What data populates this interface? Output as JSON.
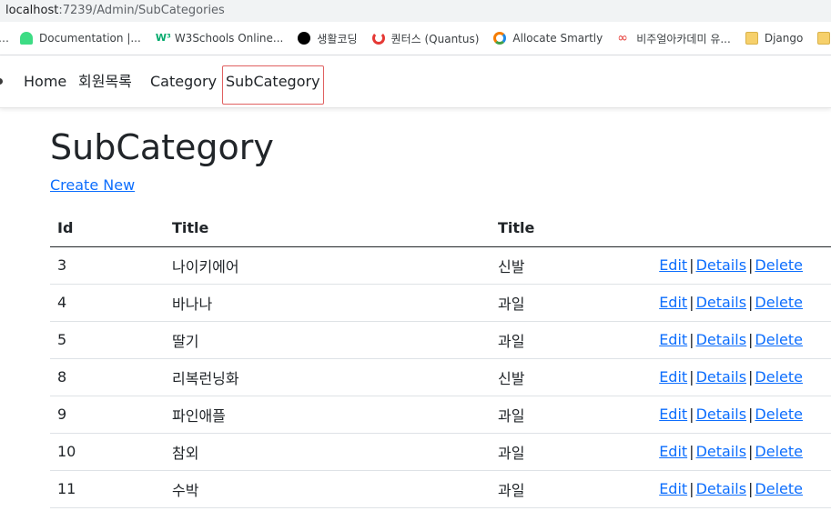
{
  "browser": {
    "url_host": "localhost",
    "url_rest": ":7239/Admin/SubCategories",
    "bookmarks": [
      {
        "label": "Documentation |...",
        "icon": "android-icon",
        "color": "#3ddc84"
      },
      {
        "label": "W3Schools Online...",
        "icon": "w3schools-icon",
        "color": "#04aa6d"
      },
      {
        "label": "생활코딩",
        "icon": "black-circle-icon",
        "color": "#000000"
      },
      {
        "label": "퀀터스 (Quantus)",
        "icon": "quantus-icon",
        "color": "#e53935"
      },
      {
        "label": "Allocate Smartly",
        "icon": "allocate-icon",
        "color": "#f57c00"
      },
      {
        "label": "비주얼아카데미 유...",
        "icon": "infinity-icon",
        "color": "#e53935"
      },
      {
        "label": "Django",
        "icon": "folder-icon",
        "color": "#f6d06b"
      }
    ]
  },
  "nav": {
    "home": "Home",
    "members": "회원목록",
    "category": "Category",
    "subcategory": "SubCategory"
  },
  "page": {
    "title": "SubCategory",
    "create_new": "Create New"
  },
  "table": {
    "headers": [
      "Id",
      "Title",
      "Title",
      ""
    ],
    "rows": [
      {
        "id": "3",
        "title": "나이키에어",
        "category": "신발"
      },
      {
        "id": "4",
        "title": "바나나",
        "category": "과일"
      },
      {
        "id": "5",
        "title": "딸기",
        "category": "과일"
      },
      {
        "id": "8",
        "title": "리복런닝화",
        "category": "신발"
      },
      {
        "id": "9",
        "title": "파인애플",
        "category": "과일"
      },
      {
        "id": "10",
        "title": "참외",
        "category": "과일"
      },
      {
        "id": "11",
        "title": "수박",
        "category": "과일"
      }
    ],
    "actions": {
      "edit": "Edit",
      "details": "Details",
      "delete": "Delete",
      "separator": "|"
    }
  },
  "colors": {
    "link": "#0d6efd",
    "active_outline": "#e06060"
  }
}
